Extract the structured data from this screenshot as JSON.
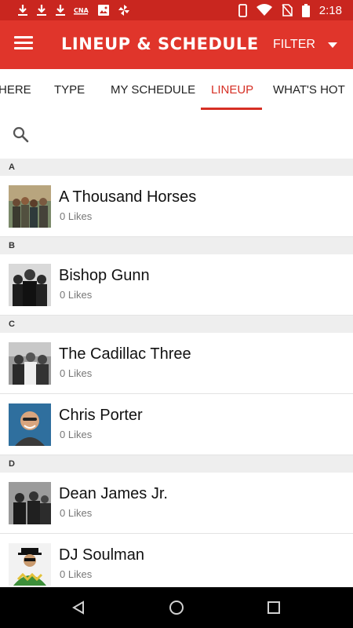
{
  "status_bar": {
    "time": "2:18",
    "left_icons": [
      "download-icon",
      "download-icon",
      "download-icon",
      "cna-icon",
      "image-icon",
      "pinwheel-icon"
    ],
    "right_icons": [
      "phone-icon",
      "wifi-icon",
      "no-sim-icon",
      "battery-icon"
    ]
  },
  "app_bar": {
    "title": "LINEUP & SCHEDULE",
    "filter_label": "FILTER",
    "menu_icon": "hamburger-icon",
    "dropdown_icon": "arrow-drop-down-icon",
    "background": "#e0352b"
  },
  "tabs": [
    {
      "label": "HERE",
      "active": false
    },
    {
      "label": "TYPE",
      "active": false
    },
    {
      "label": "MY SCHEDULE",
      "active": false
    },
    {
      "label": "LINEUP",
      "active": true
    },
    {
      "label": "WHAT'S HOT",
      "active": false
    }
  ],
  "search": {
    "icon": "search-icon",
    "placeholder": ""
  },
  "sections": [
    {
      "letter": "A",
      "items": [
        {
          "name": "A Thousand Horses",
          "likes": "0 Likes"
        }
      ]
    },
    {
      "letter": "B",
      "items": [
        {
          "name": "Bishop Gunn",
          "likes": "0 Likes"
        }
      ]
    },
    {
      "letter": "C",
      "items": [
        {
          "name": "The Cadillac Three",
          "likes": "0 Likes"
        },
        {
          "name": "Chris Porter",
          "likes": "0 Likes"
        }
      ]
    },
    {
      "letter": "D",
      "items": [
        {
          "name": "Dean James Jr.",
          "likes": "0 Likes"
        },
        {
          "name": "DJ Soulman",
          "likes": "0 Likes"
        }
      ]
    }
  ],
  "nav_bar": {
    "back_icon": "back-triangle-icon",
    "home_icon": "home-circle-icon",
    "recents_icon": "recents-square-icon"
  },
  "colors": {
    "accent": "#d62f24",
    "status_bar": "#c9261f"
  }
}
